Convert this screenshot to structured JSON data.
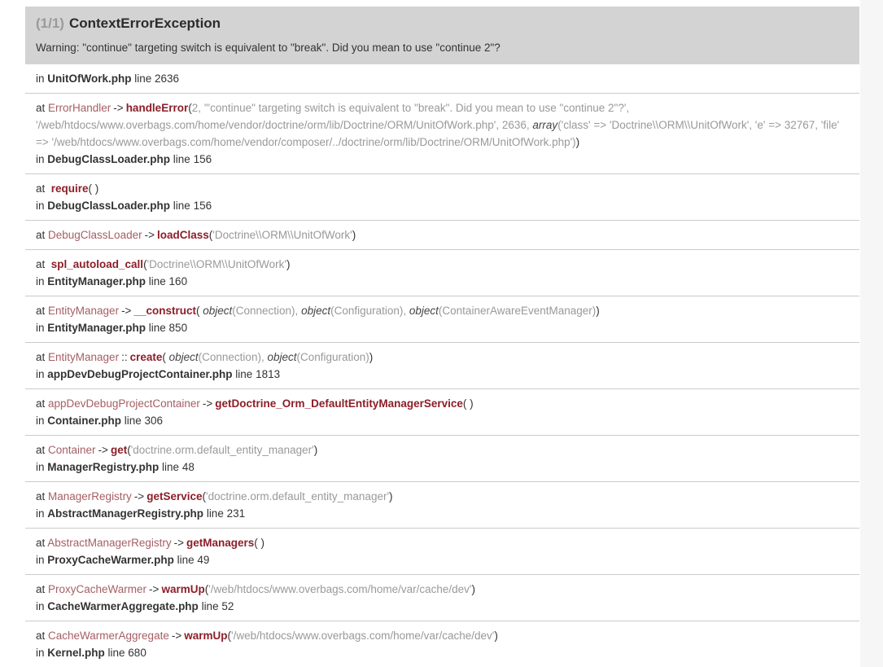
{
  "header": {
    "counter": "(1/1)",
    "title": "ContextErrorException",
    "message": "Warning: \"continue\" targeting switch is equivalent to \"break\". Did you mean to use \"continue 2\"?"
  },
  "labels": {
    "at": "at ",
    "at_wide": "at  ",
    "in": "in ",
    "line": " line "
  },
  "colors": {
    "header_bg": "#d3d3d3",
    "counter": "#9a9a9a",
    "title": "#2b2b2b",
    "text": "#333333",
    "class_link": "#a55f64",
    "method": "#8c1e28",
    "args": "#999999",
    "em": "#444444",
    "row_border": "#cbcbcb",
    "gutter_bg": "#f6f6f6",
    "panel_bg": "#ffffff"
  },
  "trace": [
    {
      "at": null,
      "in": {
        "file": "UnitOfWork.php",
        "line": "2636"
      }
    },
    {
      "at": [
        {
          "k": "plain",
          "t": "at "
        },
        {
          "k": "class",
          "t": "ErrorHandler"
        },
        {
          "k": "arrow",
          "t": "->"
        },
        {
          "k": "method",
          "t": "handleError"
        },
        {
          "k": "paren",
          "t": "("
        },
        {
          "k": "arg",
          "t": "2, '\"continue\" targeting switch is equivalent to \"break\". Did you mean to use \"continue 2\"?', '/web/htdocs/www.overbags.com/home/vendor/doctrine/orm/lib/Doctrine/ORM/UnitOfWork.php', 2636, "
        },
        {
          "k": "em",
          "t": "array"
        },
        {
          "k": "arg",
          "t": "('class' => 'Doctrine\\\\ORM\\\\UnitOfWork', 'e' => 32767, 'file' => '/web/htdocs/www.overbags.com/home/vendor/composer/../doctrine/orm/lib/Doctrine/ORM/UnitOfWork.php')"
        },
        {
          "k": "paren",
          "t": ")"
        }
      ],
      "in": {
        "file": "DebugClassLoader.php",
        "line": "156"
      }
    },
    {
      "at": [
        {
          "k": "plain",
          "t": "at  "
        },
        {
          "k": "method",
          "t": "require"
        },
        {
          "k": "paren",
          "t": "( )"
        }
      ],
      "in": {
        "file": "DebugClassLoader.php",
        "line": "156"
      }
    },
    {
      "at": [
        {
          "k": "plain",
          "t": "at "
        },
        {
          "k": "class",
          "t": "DebugClassLoader"
        },
        {
          "k": "arrow",
          "t": "->"
        },
        {
          "k": "method",
          "t": "loadClass"
        },
        {
          "k": "paren",
          "t": "("
        },
        {
          "k": "arg",
          "t": "'Doctrine\\\\ORM\\\\UnitOfWork'"
        },
        {
          "k": "paren",
          "t": ")"
        }
      ],
      "in": null
    },
    {
      "at": [
        {
          "k": "plain",
          "t": "at  "
        },
        {
          "k": "method",
          "t": "spl_autoload_call"
        },
        {
          "k": "paren",
          "t": "("
        },
        {
          "k": "arg",
          "t": "'Doctrine\\\\ORM\\\\UnitOfWork'"
        },
        {
          "k": "paren",
          "t": ")"
        }
      ],
      "in": {
        "file": "EntityManager.php",
        "line": "160"
      }
    },
    {
      "at": [
        {
          "k": "plain",
          "t": "at "
        },
        {
          "k": "class",
          "t": "EntityManager"
        },
        {
          "k": "arrow",
          "t": "->"
        },
        {
          "k": "method",
          "t": "__construct"
        },
        {
          "k": "paren",
          "t": "( "
        },
        {
          "k": "em",
          "t": "object"
        },
        {
          "k": "arg",
          "t": "(Connection), "
        },
        {
          "k": "em",
          "t": "object"
        },
        {
          "k": "arg",
          "t": "(Configuration), "
        },
        {
          "k": "em",
          "t": "object"
        },
        {
          "k": "arg",
          "t": "(ContainerAwareEventManager)"
        },
        {
          "k": "paren",
          "t": ")"
        }
      ],
      "in": {
        "file": "EntityManager.php",
        "line": "850"
      }
    },
    {
      "at": [
        {
          "k": "plain",
          "t": "at "
        },
        {
          "k": "class",
          "t": "EntityManager"
        },
        {
          "k": "arrow",
          "t": "::"
        },
        {
          "k": "method",
          "t": "create"
        },
        {
          "k": "paren",
          "t": "( "
        },
        {
          "k": "em",
          "t": "object"
        },
        {
          "k": "arg",
          "t": "(Connection), "
        },
        {
          "k": "em",
          "t": "object"
        },
        {
          "k": "arg",
          "t": "(Configuration)"
        },
        {
          "k": "paren",
          "t": ")"
        }
      ],
      "in": {
        "file": "appDevDebugProjectContainer.php",
        "line": "1813"
      }
    },
    {
      "at": [
        {
          "k": "plain",
          "t": "at "
        },
        {
          "k": "class",
          "t": "appDevDebugProjectContainer"
        },
        {
          "k": "arrow",
          "t": "->"
        },
        {
          "k": "method",
          "t": "getDoctrine_Orm_DefaultEntityManagerService"
        },
        {
          "k": "paren",
          "t": "( )"
        }
      ],
      "in": {
        "file": "Container.php",
        "line": "306"
      }
    },
    {
      "at": [
        {
          "k": "plain",
          "t": "at "
        },
        {
          "k": "class",
          "t": "Container"
        },
        {
          "k": "arrow",
          "t": "->"
        },
        {
          "k": "method",
          "t": "get"
        },
        {
          "k": "paren",
          "t": "("
        },
        {
          "k": "arg",
          "t": "'doctrine.orm.default_entity_manager'"
        },
        {
          "k": "paren",
          "t": ")"
        }
      ],
      "in": {
        "file": "ManagerRegistry.php",
        "line": "48"
      }
    },
    {
      "at": [
        {
          "k": "plain",
          "t": "at "
        },
        {
          "k": "class",
          "t": "ManagerRegistry"
        },
        {
          "k": "arrow",
          "t": "->"
        },
        {
          "k": "method",
          "t": "getService"
        },
        {
          "k": "paren",
          "t": "("
        },
        {
          "k": "arg",
          "t": "'doctrine.orm.default_entity_manager'"
        },
        {
          "k": "paren",
          "t": ")"
        }
      ],
      "in": {
        "file": "AbstractManagerRegistry.php",
        "line": "231"
      }
    },
    {
      "at": [
        {
          "k": "plain",
          "t": "at "
        },
        {
          "k": "class",
          "t": "AbstractManagerRegistry"
        },
        {
          "k": "arrow",
          "t": "->"
        },
        {
          "k": "method",
          "t": "getManagers"
        },
        {
          "k": "paren",
          "t": "( )"
        }
      ],
      "in": {
        "file": "ProxyCacheWarmer.php",
        "line": "49"
      }
    },
    {
      "at": [
        {
          "k": "plain",
          "t": "at "
        },
        {
          "k": "class",
          "t": "ProxyCacheWarmer"
        },
        {
          "k": "arrow",
          "t": "->"
        },
        {
          "k": "method",
          "t": "warmUp"
        },
        {
          "k": "paren",
          "t": "("
        },
        {
          "k": "arg",
          "t": "'/web/htdocs/www.overbags.com/home/var/cache/dev'"
        },
        {
          "k": "paren",
          "t": ")"
        }
      ],
      "in": {
        "file": "CacheWarmerAggregate.php",
        "line": "52"
      }
    },
    {
      "at": [
        {
          "k": "plain",
          "t": "at "
        },
        {
          "k": "class",
          "t": "CacheWarmerAggregate"
        },
        {
          "k": "arrow",
          "t": "->"
        },
        {
          "k": "method",
          "t": "warmUp"
        },
        {
          "k": "paren",
          "t": "("
        },
        {
          "k": "arg",
          "t": "'/web/htdocs/www.overbags.com/home/var/cache/dev'"
        },
        {
          "k": "paren",
          "t": ")"
        }
      ],
      "in": {
        "file": "Kernel.php",
        "line": "680"
      }
    }
  ]
}
